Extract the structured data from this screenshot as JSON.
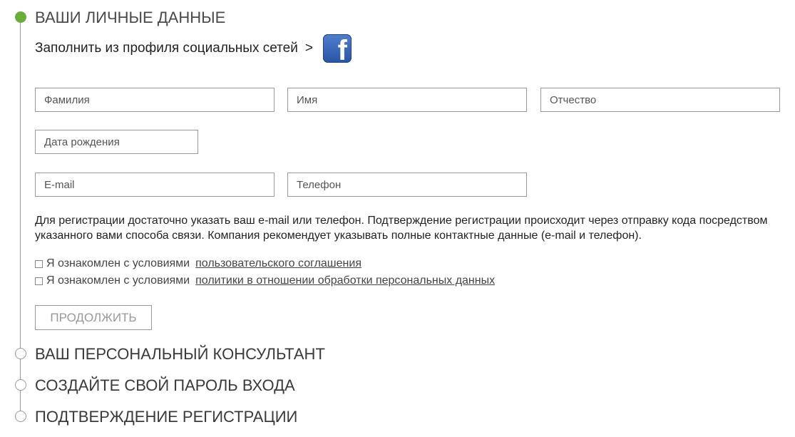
{
  "steps": [
    {
      "title": "ВАШИ ЛИЧНЫЕ ДАННЫЕ",
      "active": true
    },
    {
      "title": "ВАШ ПЕРСОНАЛЬНЫЙ КОНСУЛЬТАНТ",
      "active": false
    },
    {
      "title": "СОЗДАЙТЕ СВОЙ ПАРОЛЬ ВХОДА",
      "active": false
    },
    {
      "title": "ПОДТВЕРЖДЕНИЕ РЕГИСТРАЦИИ",
      "active": false
    }
  ],
  "social": {
    "text": "Заполнить из профиля социальных сетей",
    "arrow": ">",
    "facebook_icon": "facebook-icon",
    "facebook_glyph": "f"
  },
  "form": {
    "last_name": {
      "placeholder": "Фамилия",
      "value": ""
    },
    "first_name": {
      "placeholder": "Имя",
      "value": ""
    },
    "middle_name": {
      "placeholder": "Отчество",
      "value": ""
    },
    "birth_date": {
      "placeholder": "Дата рождения",
      "value": ""
    },
    "email": {
      "placeholder": "E-mail",
      "value": ""
    },
    "phone": {
      "placeholder": "Телефон",
      "value": ""
    }
  },
  "info": {
    "line1": "Для регистрации достаточно указать ваш e-mail или телефон. Подтверждение регистрации происходит через отправку кода посредством",
    "line2": "указанного вами способа связи. Компания рекомендует указывать полные контактные данные (e-mail и телефон)."
  },
  "agreements": [
    {
      "label": "Я ознакомлен с условиями",
      "link": "пользовательского соглашения",
      "checked": false
    },
    {
      "label": "Я ознакомлен с условиями",
      "link": "политики в отношении обработки персональных данных",
      "checked": false
    }
  ],
  "continue_label": "ПРОДОЛЖИТЬ",
  "colors": {
    "active_step": "#6aae37",
    "border": "#9a9a9a",
    "facebook": "#3b5998"
  }
}
